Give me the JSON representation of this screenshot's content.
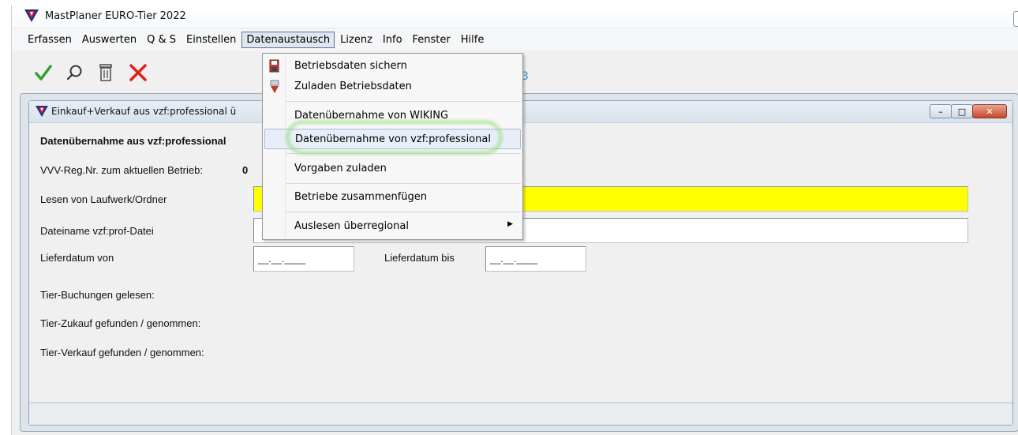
{
  "app": {
    "title": "MastPlaner EURO-Tier 2022"
  },
  "menu": {
    "items": [
      {
        "label": "Erfassen",
        "active": false
      },
      {
        "label": "Auswerten",
        "active": false
      },
      {
        "label": "Q & S",
        "active": false
      },
      {
        "label": "Einstellen",
        "active": false
      },
      {
        "label": "Datenaustausch",
        "active": true
      },
      {
        "label": "Lizenz",
        "active": false
      },
      {
        "label": "Info",
        "active": false
      },
      {
        "label": "Fenster",
        "active": false
      },
      {
        "label": "Hilfe",
        "active": false
      }
    ]
  },
  "toolbar": {
    "buttons": [
      {
        "icon": "checkmark-icon",
        "color": "#2fa12f"
      },
      {
        "icon": "search-icon",
        "color": "#333333"
      },
      {
        "icon": "trash-icon",
        "color": "#555555"
      },
      {
        "icon": "close-icon",
        "color": "#e0201b"
      }
    ],
    "hint_text": "3"
  },
  "child_window": {
    "title": "Einkauf+Verkauf aus vzf:professional ü",
    "buttons": {
      "minimize": "–",
      "maximize": "□",
      "close": "✕"
    }
  },
  "form": {
    "heading": "Datenübernahme aus vzf:professional",
    "reg_label": "VVV-Reg.Nr. zum aktuellen Betrieb:",
    "reg_value": "0",
    "drive_label": "Lesen von Laufwerk/Ordner",
    "drive_value": "",
    "filename_label": "Dateiname vzf:prof-Datei",
    "filename_value": "",
    "date_from_label": "Lieferdatum von",
    "date_from_value": "__.__.____",
    "date_to_label": "Lieferdatum bis",
    "date_to_value": "__.__.____",
    "bookings_label": "Tier-Buchungen gelesen:",
    "purchase_label": "Tier-Zukauf  gefunden / genommen:",
    "sale_label": "Tier-Verkauf gefunden / genommen:",
    "highlight_color": "#ffff00"
  },
  "dropdown": {
    "items": [
      {
        "label": "Betriebsdaten sichern",
        "icon": "save-disk-icon"
      },
      {
        "label": "Zuladen Betriebsdaten",
        "icon": "load-data-icon"
      },
      {
        "label": "Datenübernahme von WIKING",
        "icon": ""
      },
      {
        "label": "Datenübernahme von vzf:professional",
        "icon": "",
        "highlighted": true
      },
      {
        "label": "Vorgaben zuladen",
        "icon": ""
      },
      {
        "label": "Betriebe zusammenfügen",
        "icon": ""
      },
      {
        "label": "Auslesen überregional",
        "icon": "",
        "submenu": true
      }
    ],
    "submenu_arrow": "▶"
  }
}
